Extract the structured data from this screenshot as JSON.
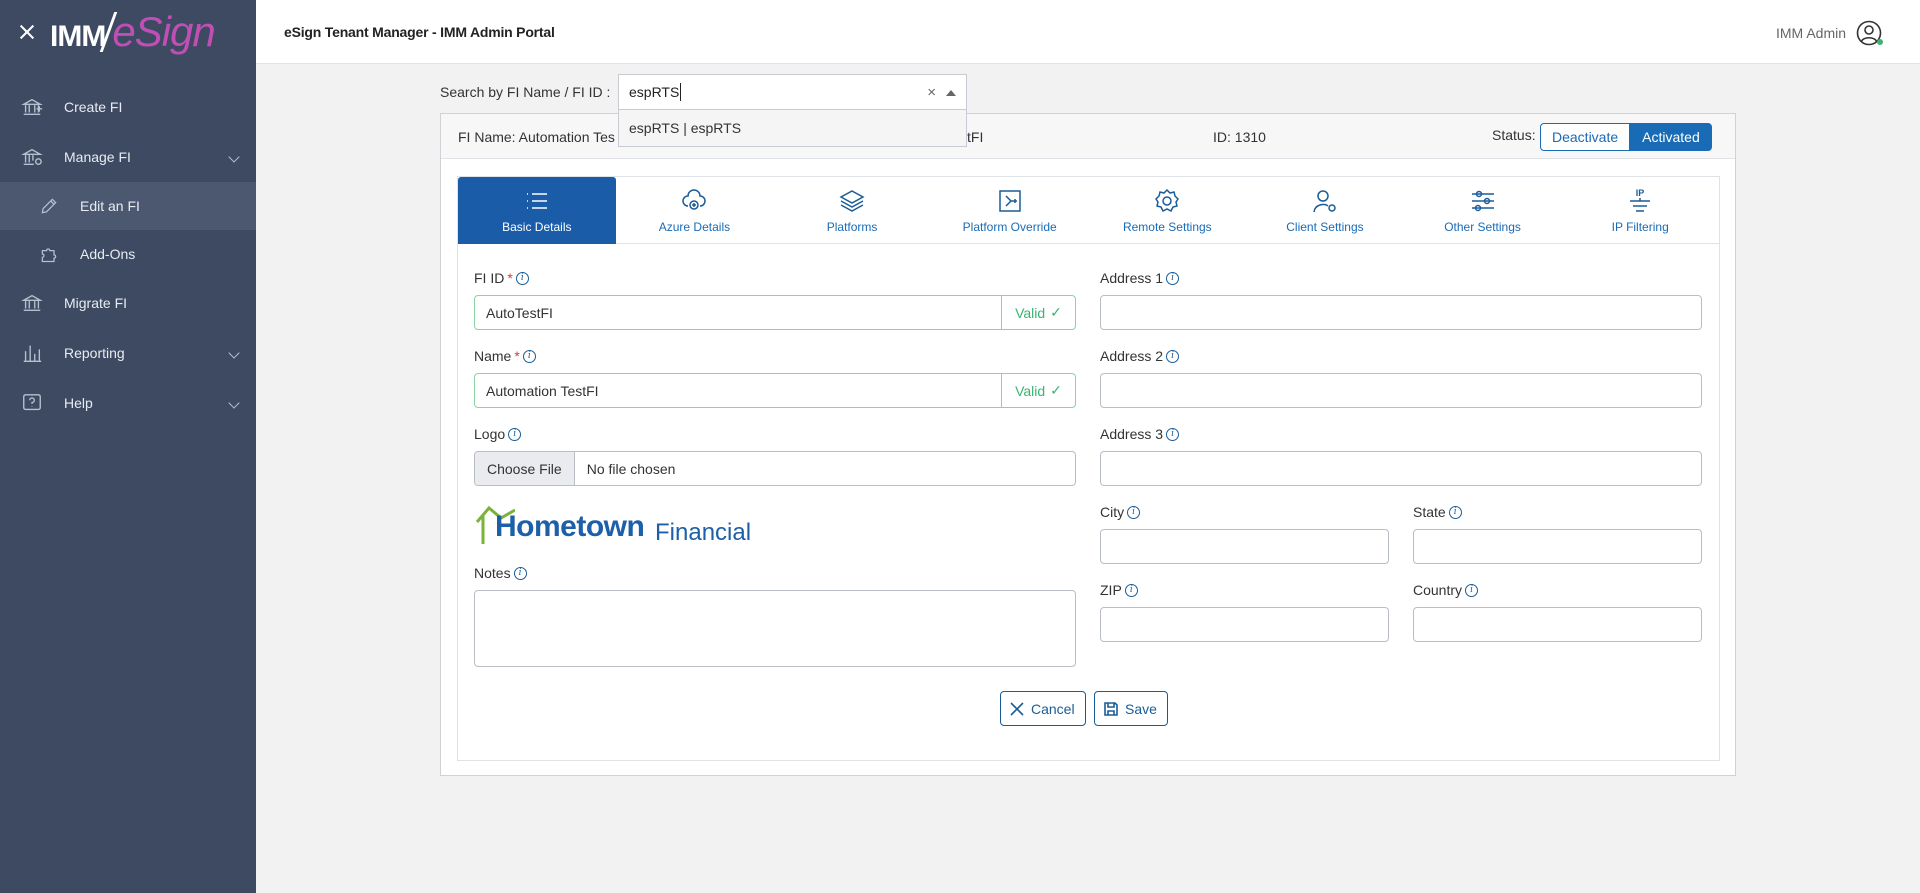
{
  "sidebar": {
    "logo_left": "IMM",
    "logo_right": "eSign",
    "items": [
      {
        "label": "Create FI"
      },
      {
        "label": "Manage FI"
      },
      {
        "label": "Edit an FI"
      },
      {
        "label": "Add-Ons"
      },
      {
        "label": "Migrate FI"
      },
      {
        "label": "Reporting"
      },
      {
        "label": "Help"
      }
    ]
  },
  "header": {
    "title": "eSign Tenant Manager - IMM Admin Portal",
    "user": "IMM Admin"
  },
  "search": {
    "label": "Search by FI Name / FI ID :",
    "value": "espRTS",
    "clear": "×",
    "option": "espRTS | espRTS"
  },
  "fi": {
    "name_label": "FI Name: Automation Tes",
    "id_tail": "tFI",
    "id": "ID: 1310",
    "status_label": "Status:",
    "deactivate": "Deactivate",
    "activated": "Activated"
  },
  "tabs": [
    {
      "label": "Basic Details"
    },
    {
      "label": "Azure Details"
    },
    {
      "label": "Platforms"
    },
    {
      "label": "Platform Override"
    },
    {
      "label": "Remote Settings"
    },
    {
      "label": "Client Settings"
    },
    {
      "label": "Other Settings"
    },
    {
      "label": "IP Filtering"
    }
  ],
  "form": {
    "fi_id_label": "FI ID",
    "fi_id_value": "AutoTestFI",
    "valid": "Valid",
    "check": "✓",
    "req": "*",
    "name_label": "Name",
    "name_value": "Automation TestFI",
    "logo_label": "Logo",
    "choose_file": "Choose File",
    "no_file": "No file chosen",
    "notes_label": "Notes",
    "address1": "Address 1",
    "address2": "Address 2",
    "address3": "Address 3",
    "city": "City",
    "state": "State",
    "zip": "ZIP",
    "country": "Country",
    "info_glyph": "i",
    "ip_glyph": "IP",
    "logo_text_1": "Hometown",
    "logo_text_2": "Financial"
  },
  "actions": {
    "cancel": "Cancel",
    "save": "Save"
  }
}
